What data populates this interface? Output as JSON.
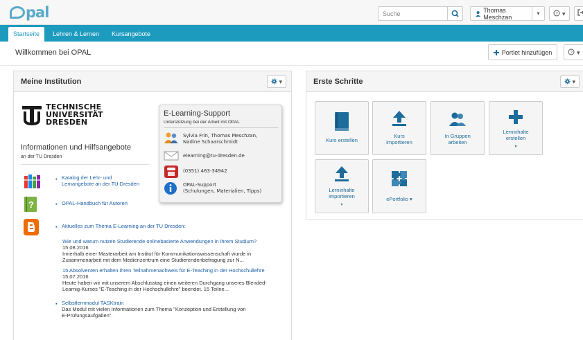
{
  "header": {
    "logo_text": "pal",
    "search_placeholder": "Suche",
    "user_name": "Thomas Meschzan",
    "help_label": "?",
    "caret": "▾"
  },
  "nav": {
    "tabs": [
      {
        "label": "Startseite"
      },
      {
        "label": "Lehren & Lernen"
      },
      {
        "label": "Kursangebote"
      }
    ]
  },
  "page": {
    "title": "Willkommen bei OPAL",
    "add_portlet_label": "Portlet hinzufügen"
  },
  "institution": {
    "title": "Meine Institution",
    "logo_lines": [
      "TECHNISCHE",
      "UNIVERSITÄT",
      "DRESDEN"
    ],
    "heading": "Informationen und Hilfsangebote",
    "subheading": "an der TU Dresden",
    "links": [
      {
        "line1": "Katalog der Lehr- und",
        "line2": "Lernangebote an der TU Dresden"
      },
      {
        "line1": "OPAL-Handbuch für Autoren",
        "line2": ""
      },
      {
        "line1": "Aktuelles zum Thema E-Learning an der TU Dresden:",
        "line2": ""
      }
    ],
    "news": [
      {
        "title": "Wie und warum nutzen Studierende onlinebasierte Anwendungen in ihrem Studium?",
        "date": "15.08.2016",
        "body1": "Innerhalb einer Masterarbeit am Institut für Kommunikationswissenschaft wurde in",
        "body2": "Zusammenarbeit mit dem Medienzentrum eine Studierendenbefragung zur N..."
      },
      {
        "title": "15 Absolventen erhalten ihren Teilnahmenachweis für E-Teaching in der Hochschullehre",
        "date": "15.07.2016",
        "body1": "Heute haben wir mit unserem Abschlusstag einen weiteren Durchgang unseres Blended-",
        "body2": "Learnig-Kurses \"E-Teaching in der Hochschullehre\" beendet. 15 Teilne..."
      }
    ],
    "module": {
      "title": "Selbstlernmodul TASKtrain",
      "body1": "Das Modul mit vielen Informationen zum Thema \"Konzeption und Erstellung von",
      "body2": "E-Prüfungsaufgaben\"."
    }
  },
  "support": {
    "title": "E-Learning-Support",
    "subtitle": "Unterstützung bei der Arbeit mit OPAL",
    "names1": "Sylvia Frin, Thomas Meschzan,",
    "names2": "Nadine Schaarschmidt",
    "email": "elearning@tu-dresden.de",
    "phone": "(0351) 463-34942",
    "link1": "OPAL-Support",
    "link2": "(Schulungen, Materialien, Tipps)"
  },
  "first_steps": {
    "title": "Erste Schritte",
    "tiles": [
      {
        "line1": "Kurs erstellen",
        "line2": ""
      },
      {
        "line1": "Kurs",
        "line2": "importieren"
      },
      {
        "line1": "In Gruppen",
        "line2": "arbeiten"
      },
      {
        "line1": "Lerninhalte",
        "line2": "erstellen"
      },
      {
        "line1": "Lerninhalte",
        "line2": "importieren"
      },
      {
        "line1": "ePortfolio ▾",
        "line2": ""
      }
    ]
  },
  "colors": {
    "accent": "#1d9bbf",
    "link": "#1d5fa8",
    "tile_icon": "#1d6c9c"
  }
}
